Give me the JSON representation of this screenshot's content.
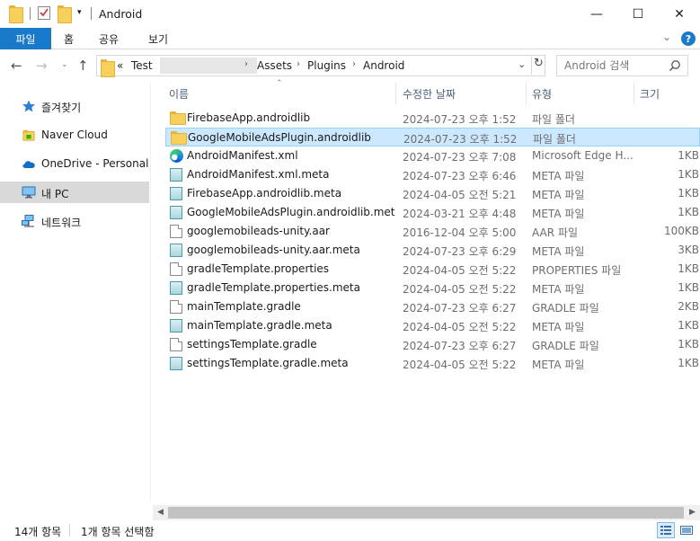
{
  "window": {
    "title": "Android",
    "minimize": "—",
    "maximize": "☐",
    "close": "✕"
  },
  "ribbon": {
    "tabs": [
      "파일",
      "홈",
      "공유",
      "보기"
    ],
    "help": "?"
  },
  "address": {
    "crumbs": [
      "Test",
      "Assets",
      "Plugins",
      "Android"
    ],
    "overflow": "«"
  },
  "search": {
    "placeholder": "Android 검색"
  },
  "sidebar": {
    "items": [
      {
        "label": "즐겨찾기",
        "icon": "star-icon"
      },
      {
        "label": "Naver Cloud",
        "icon": "naver-cloud-icon"
      },
      {
        "label": "OneDrive - Personal",
        "icon": "onedrive-icon"
      },
      {
        "label": "내 PC",
        "icon": "pc-icon",
        "selected": true
      },
      {
        "label": "네트워크",
        "icon": "network-icon"
      }
    ]
  },
  "columns": {
    "name": "이름",
    "date": "수정한 날짜",
    "type": "유형",
    "size": "크기"
  },
  "files": [
    {
      "name": "FirebaseApp.androidlib",
      "date": "2024-07-23 오후 1:52",
      "type": "파일 폴더",
      "size": "",
      "icon": "folder"
    },
    {
      "name": "GoogleMobileAdsPlugin.androidlib",
      "date": "2024-07-23 오후 1:52",
      "type": "파일 폴더",
      "size": "",
      "icon": "folder",
      "selected": true
    },
    {
      "name": "AndroidManifest.xml",
      "date": "2024-07-23 오후 7:08",
      "type": "Microsoft Edge H...",
      "size": "1KB",
      "icon": "edge"
    },
    {
      "name": "AndroidManifest.xml.meta",
      "date": "2024-07-23 오후 6:46",
      "type": "META 파일",
      "size": "1KB",
      "icon": "meta"
    },
    {
      "name": "FirebaseApp.androidlib.meta",
      "date": "2024-04-05 오전 5:21",
      "type": "META 파일",
      "size": "1KB",
      "icon": "meta"
    },
    {
      "name": "GoogleMobileAdsPlugin.androidlib.meta",
      "date": "2024-03-21 오후 4:48",
      "type": "META 파일",
      "size": "1KB",
      "icon": "meta"
    },
    {
      "name": "googlemobileads-unity.aar",
      "date": "2016-12-04 오후 5:00",
      "type": "AAR 파일",
      "size": "100KB",
      "icon": "file"
    },
    {
      "name": "googlemobileads-unity.aar.meta",
      "date": "2024-07-23 오후 6:29",
      "type": "META 파일",
      "size": "3KB",
      "icon": "meta"
    },
    {
      "name": "gradleTemplate.properties",
      "date": "2024-04-05 오전 5:22",
      "type": "PROPERTIES 파일",
      "size": "1KB",
      "icon": "file"
    },
    {
      "name": "gradleTemplate.properties.meta",
      "date": "2024-04-05 오전 5:22",
      "type": "META 파일",
      "size": "1KB",
      "icon": "meta"
    },
    {
      "name": "mainTemplate.gradle",
      "date": "2024-07-23 오후 6:27",
      "type": "GRADLE 파일",
      "size": "2KB",
      "icon": "file"
    },
    {
      "name": "mainTemplate.gradle.meta",
      "date": "2024-04-05 오전 5:22",
      "type": "META 파일",
      "size": "1KB",
      "icon": "meta"
    },
    {
      "name": "settingsTemplate.gradle",
      "date": "2024-07-23 오후 6:27",
      "type": "GRADLE 파일",
      "size": "1KB",
      "icon": "file"
    },
    {
      "name": "settingsTemplate.gradle.meta",
      "date": "2024-04-05 오전 5:22",
      "type": "META 파일",
      "size": "1KB",
      "icon": "meta"
    }
  ],
  "status": {
    "count": "14개 항목",
    "selection": "1개 항목 선택함"
  },
  "colors": {
    "accent": "#1979ca",
    "selection": "#cce8ff",
    "selection_border": "#99d1ff",
    "header_text": "#4c607a",
    "secondary_text": "#6d6d6d"
  }
}
